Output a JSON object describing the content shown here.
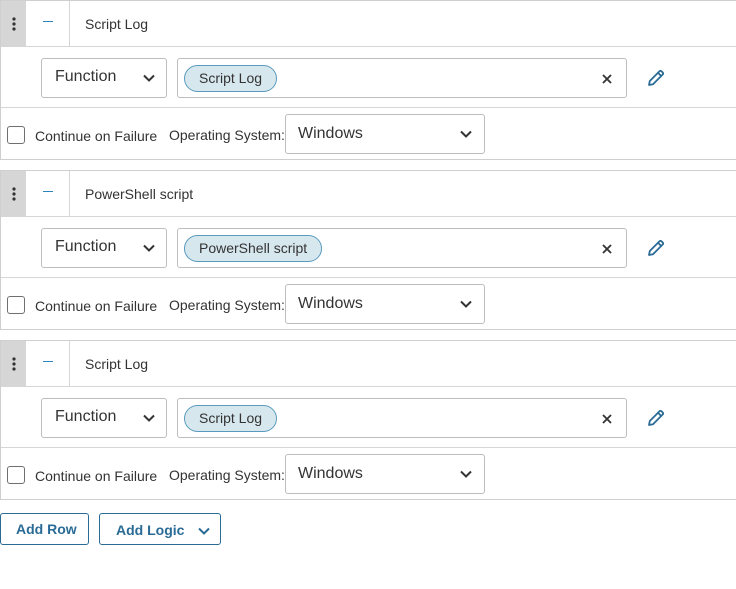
{
  "steps": [
    {
      "title": "Script Log",
      "type_value": "Function",
      "chip_label": "Script Log",
      "continue_on_failure_label": "Continue on Failure",
      "continue_on_failure_checked": false,
      "os_label": "Operating System:",
      "os_value": "Windows"
    },
    {
      "title": "PowerShell script",
      "type_value": "Function",
      "chip_label": "PowerShell script",
      "continue_on_failure_label": "Continue on Failure",
      "continue_on_failure_checked": false,
      "os_label": "Operating System:",
      "os_value": "Windows"
    },
    {
      "title": "Script Log",
      "type_value": "Function",
      "chip_label": "Script Log",
      "continue_on_failure_label": "Continue on Failure",
      "continue_on_failure_checked": false,
      "os_label": "Operating System:",
      "os_value": "Windows"
    }
  ],
  "footer": {
    "add_row_label": "Add Row",
    "add_logic_label": "Add Logic"
  },
  "icons": {
    "drag": "vertical-dots-icon",
    "collapse": "minus-icon",
    "dropdown": "chevron-down-icon",
    "clear": "close-icon",
    "edit": "pencil-icon"
  },
  "colors": {
    "accent": "#2a87b8",
    "button_text": "#2a6b96",
    "chip_bg": "#d7e7ee",
    "chip_border": "#5a9bbd",
    "drag_handle_bg": "#d6d6d6"
  }
}
